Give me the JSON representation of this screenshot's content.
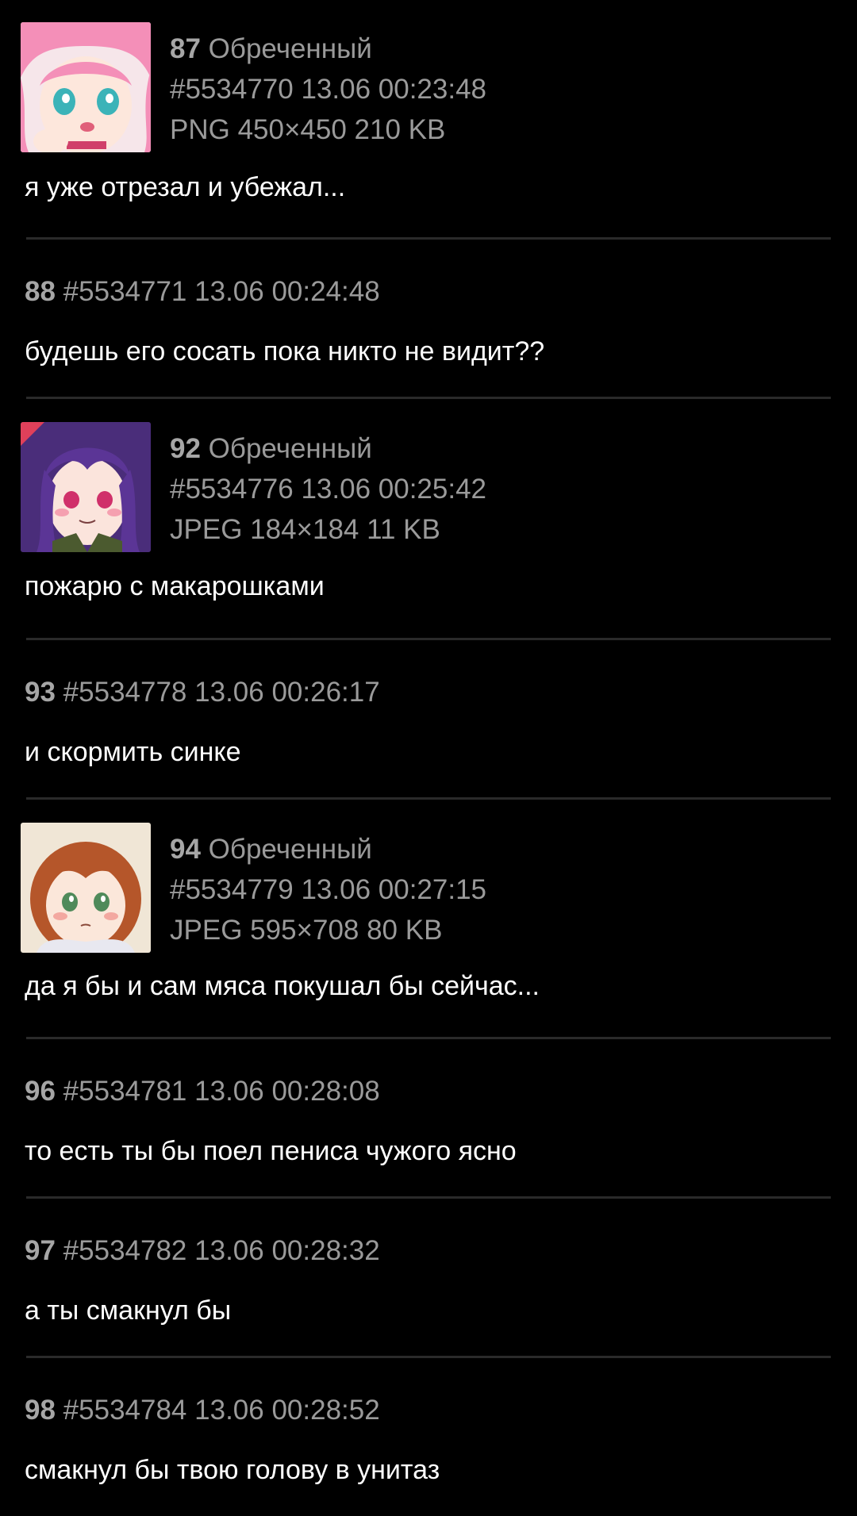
{
  "posts": [
    {
      "num": "87",
      "name": "Обреченный",
      "id": "#5534770",
      "datetime": "13.06 00:23:48",
      "file": "PNG 450×450 210 KB",
      "text": "я уже отрезал и убежал...",
      "thumb": "anime-girl-pink-hair-thumbnail"
    },
    {
      "num": "88",
      "id": "#5534771",
      "datetime": "13.06 00:24:48",
      "text": "будешь его сосать пока никто не видит??"
    },
    {
      "num": "92",
      "name": "Обреченный",
      "id": "#5534776",
      "datetime": "13.06 00:25:42",
      "file": "JPEG 184×184 11 KB",
      "text": "пожарю с макарошками",
      "thumb": "anime-girl-purple-hair-thumbnail"
    },
    {
      "num": "93",
      "id": "#5534778",
      "datetime": "13.06 00:26:17",
      "text": "и скормить синке"
    },
    {
      "num": "94",
      "name": "Обреченный",
      "id": "#5534779",
      "datetime": "13.06 00:27:15",
      "file": "JPEG 595×708 80 KB",
      "text": "да я бы и сам мяса покушал бы сейчас...",
      "thumb": "anime-girl-brown-hair-thumbnail"
    },
    {
      "num": "96",
      "id": "#5534781",
      "datetime": "13.06 00:28:08",
      "text": "то есть ты бы поел пениса чужого ясно"
    },
    {
      "num": "97",
      "id": "#5534782",
      "datetime": "13.06 00:28:32",
      "text": "а ты смакнул бы"
    },
    {
      "num": "98",
      "id": "#5534784",
      "datetime": "13.06 00:28:52",
      "text": "смакнул бы твою голову в унитаз"
    }
  ],
  "colors": {
    "background": "#000000",
    "meta_text": "#9a9a9a",
    "body_text": "#ffffff",
    "divider": "#2a2a2a"
  }
}
